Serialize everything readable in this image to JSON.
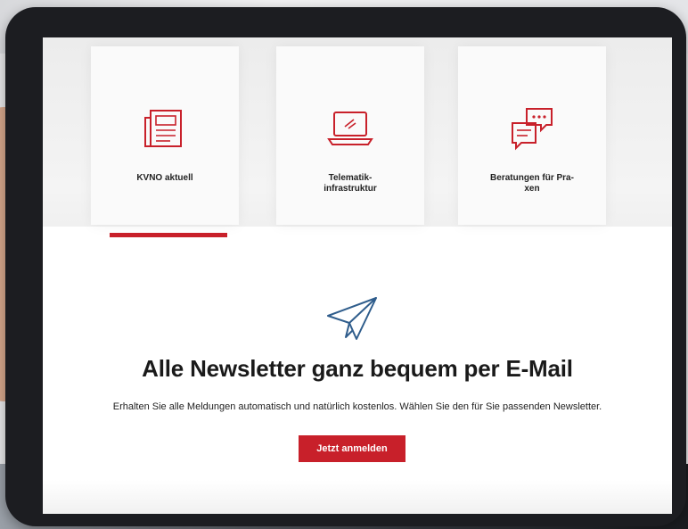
{
  "tiles": [
    {
      "label": "KVNO aktuell",
      "icon": "newspaper-icon"
    },
    {
      "label": "Telematik-\ninfrastruktur",
      "icon": "laptop-icon"
    },
    {
      "label": "Beratungen für Pra-\nxen",
      "icon": "chat-bubbles-icon"
    }
  ],
  "newsletter": {
    "icon": "paper-plane-icon",
    "headline": "Alle Newsletter ganz bequem per E-Mail",
    "subtext": "Erhalten Sie alle Meldungen automatisch und natürlich kostenlos. Wählen Sie den für Sie passenden Newsletter.",
    "cta_label": "Jetzt anmelden"
  },
  "colors": {
    "accent": "#c8202a",
    "text": "#1a1a1a"
  }
}
